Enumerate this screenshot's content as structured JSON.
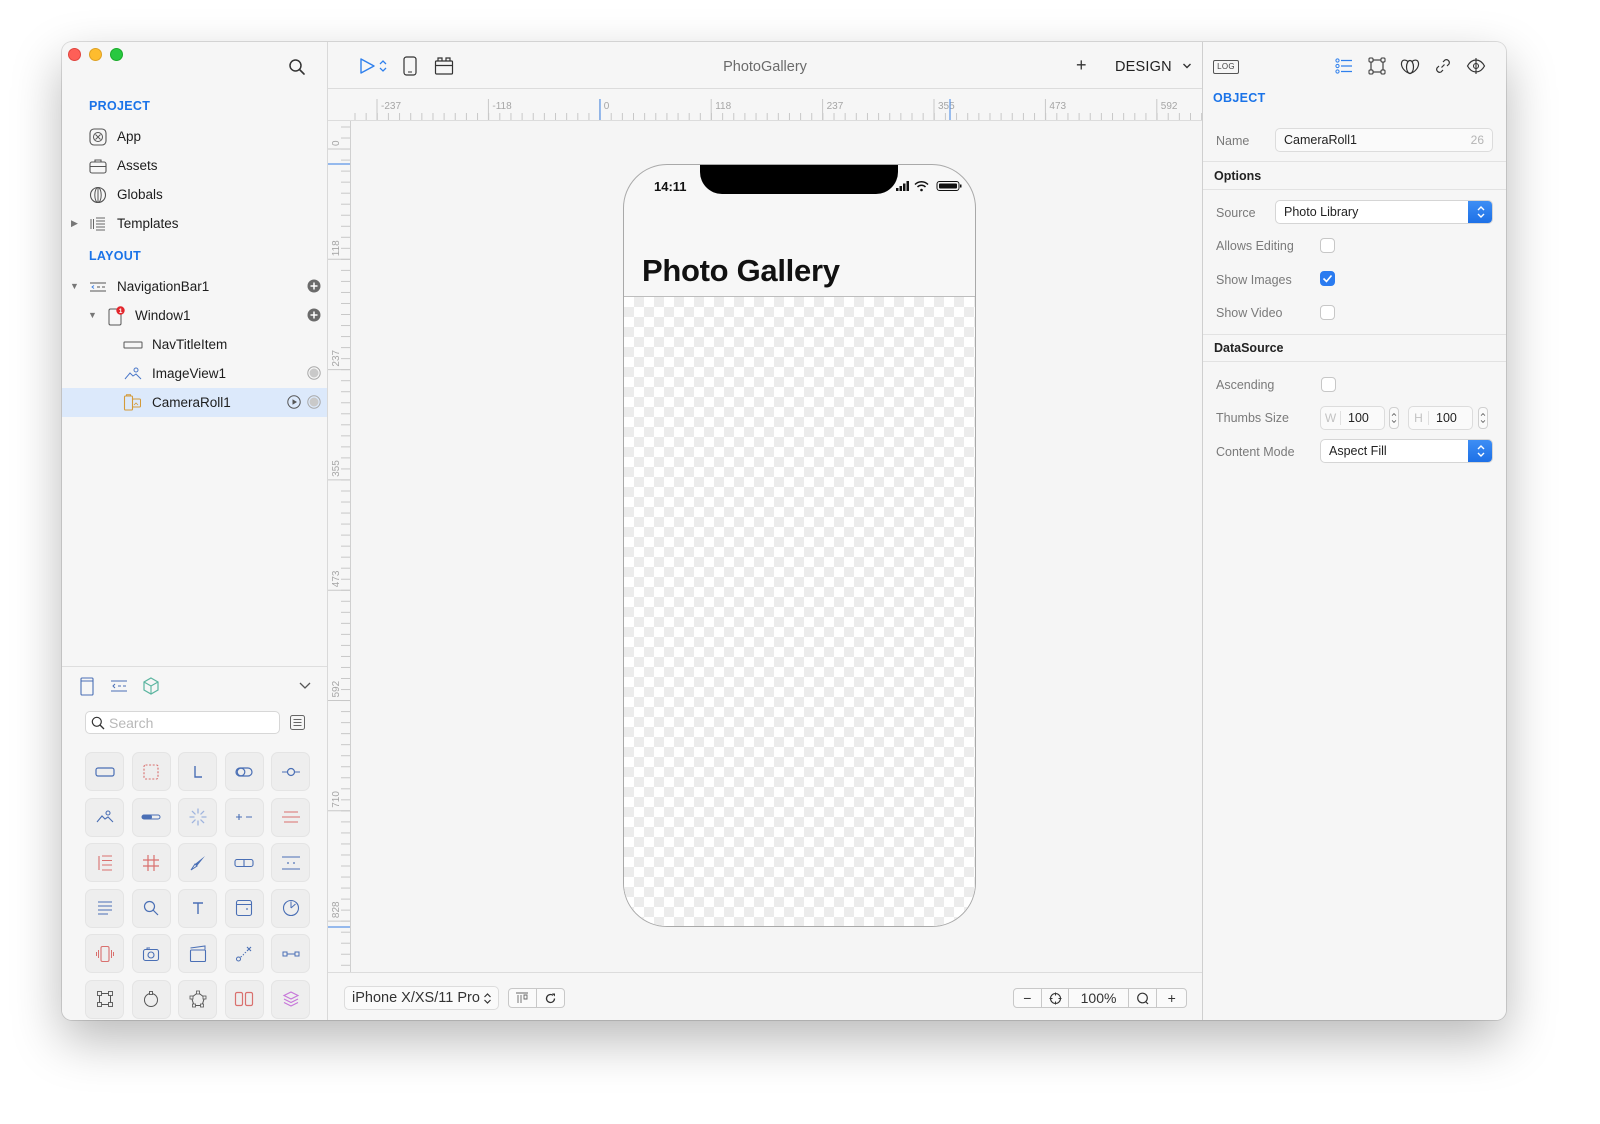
{
  "window": {
    "title": "PhotoGallery"
  },
  "sidebar": {
    "project_title": "PROJECT",
    "project_items": [
      {
        "label": "App",
        "icon": "app-icon"
      },
      {
        "label": "Assets",
        "icon": "briefcase-icon"
      },
      {
        "label": "Globals",
        "icon": "globe-icon"
      },
      {
        "label": "Templates",
        "icon": "templates-icon",
        "collapsed": true
      }
    ],
    "layout_title": "LAYOUT",
    "layout_items": [
      {
        "label": "NavigationBar1",
        "icon": "navigation-bar-icon",
        "expanded": true,
        "action": "add"
      },
      {
        "label": "Window1",
        "icon": "window-icon",
        "expanded": true,
        "badge": "1",
        "action": "add"
      },
      {
        "label": "NavTitleItem",
        "icon": "nav-title-item-icon"
      },
      {
        "label": "ImageView1",
        "icon": "image-view-icon",
        "action": "dot"
      },
      {
        "label": "CameraRoll1",
        "icon": "camera-roll-icon",
        "selected": true,
        "action": "play-dot"
      }
    ],
    "library": {
      "search_placeholder": "Search",
      "search_value": "",
      "tabs": [
        "views-tab",
        "navigation-tab",
        "objects-tab"
      ],
      "components": [
        "button",
        "view",
        "label",
        "switch",
        "slider",
        "image-view",
        "progress-bar",
        "activity-indicator",
        "stepper",
        "separator",
        "table-view",
        "grid-view",
        "compass",
        "segmented-control",
        "page-control",
        "text-view",
        "search-bar",
        "text-field",
        "date-picker",
        "timer",
        "vibration",
        "camera",
        "video-player",
        "gesture",
        "connector",
        "shape",
        "circle-path",
        "polygon",
        "split-view",
        "layers"
      ]
    }
  },
  "toolbar": {
    "title": "PhotoGallery",
    "plus_label": "+",
    "mode_label": "DESIGN"
  },
  "rulers": {
    "horizontal_labels": [
      "-237",
      "-118",
      "0",
      "118",
      "237",
      "355",
      "473",
      "592"
    ],
    "vertical_labels": [
      "0",
      "118",
      "237",
      "355",
      "473",
      "592",
      "710",
      "828"
    ]
  },
  "phone": {
    "status_time": "14:11",
    "nav_title": "Photo Gallery"
  },
  "bottom_bar": {
    "device": "iPhone X/XS/11 Pro",
    "zoom": "100%",
    "zoom_out_label": "−",
    "zoom_in_label": "+"
  },
  "inspector": {
    "log_label": "LOG",
    "heading": "OBJECT",
    "name_label": "Name",
    "name_value": "CameraRoll1",
    "name_counter": "26",
    "options_title": "Options",
    "source_label": "Source",
    "source_value": "Photo Library",
    "allows_editing_label": "Allows Editing",
    "allows_editing": false,
    "show_images_label": "Show Images",
    "show_images": true,
    "show_video_label": "Show Video",
    "show_video": false,
    "datasource_title": "DataSource",
    "ascending_label": "Ascending",
    "ascending": false,
    "thumbs_label": "Thumbs Size",
    "thumbs_w_prefix": "W",
    "thumbs_w": "100",
    "thumbs_h_prefix": "H",
    "thumbs_h": "100",
    "content_mode_label": "Content Mode",
    "content_mode_value": "Aspect Fill"
  },
  "colors": {
    "accent": "#1a73e8",
    "selection": "#dce9fb",
    "checkbox_on": "#2a7bf0"
  }
}
